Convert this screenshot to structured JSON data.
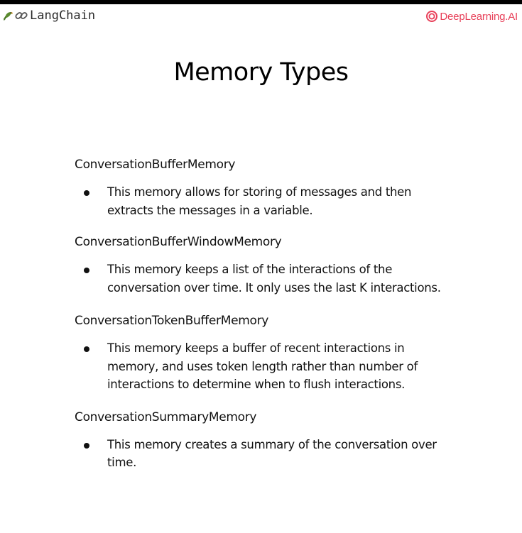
{
  "header": {
    "left_logo_text": "LangChain",
    "left_logo_icons": [
      "parrot-icon",
      "link-icon"
    ],
    "right_logo_text": "DeepLearning.AI",
    "right_logo_icon": "deeplearning-ai-icon",
    "brand_color": "#e8415a"
  },
  "title": "Memory Types",
  "memory_types": [
    {
      "name": "ConversationBufferMemory",
      "description": "This memory allows for storing of messages and then extracts the messages in a variable."
    },
    {
      "name": "ConversationBufferWindowMemory",
      "description": "This memory keeps a list of the interactions of the conversation over time. It only uses the last K interactions."
    },
    {
      "name": "ConversationTokenBufferMemory",
      "description": "This memory keeps a buffer of recent interactions in memory, and uses token length rather than number of interactions to determine when to flush interactions."
    },
    {
      "name": "ConversationSummaryMemory",
      "description": "This memory creates a summary of the conversation over time."
    }
  ]
}
